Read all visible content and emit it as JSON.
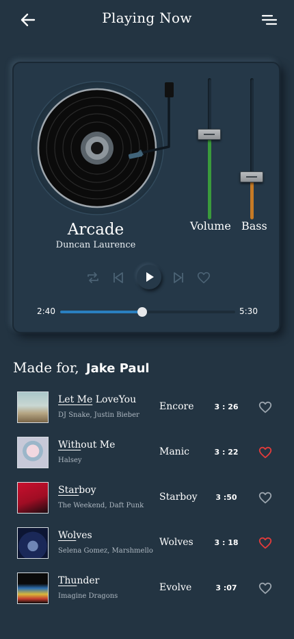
{
  "header": {
    "title": "Playing Now",
    "back_icon": "arrow-left-icon",
    "menu_icon": "menu-icon"
  },
  "player": {
    "track_title": "Arcade",
    "track_artist": "Duncan Laurence",
    "volume_label": "Volume",
    "volume_level": 0.6,
    "bass_label": "Bass",
    "bass_level": 0.3,
    "elapsed": "2:40",
    "duration": "5:30",
    "progress": 0.47,
    "controls": [
      "repeat-icon",
      "previous-icon",
      "play-icon",
      "next-icon",
      "heart-icon"
    ]
  },
  "playlist": {
    "heading_prefix": "Made for,",
    "user": "Jake Paul",
    "songs": [
      {
        "title_underlined": "Let Me",
        "title_rest": " LoveYou",
        "artist": "DJ Snake, Justin Bieber",
        "album": "Encore",
        "duration": "3 : 26",
        "liked": false
      },
      {
        "title_underlined": "With",
        "title_rest": "out Me",
        "artist": "Halsey",
        "album": "Manic",
        "duration": "3 : 22",
        "liked": true
      },
      {
        "title_underlined": "Star",
        "title_rest": "boy",
        "artist": "The Weekend, Daft Punk",
        "album": "Starboy",
        "duration": "3 :50",
        "liked": false
      },
      {
        "title_underlined": "Wol",
        "title_rest": "ves",
        "artist": "Selena Gomez, Marshmello",
        "album": "Wolves",
        "duration": "3 : 18",
        "liked": true
      },
      {
        "title_underlined": "Thu",
        "title_rest": "nder",
        "artist": "Imagine Dragons",
        "album": "Evolve",
        "duration": "3 :07",
        "liked": false
      }
    ]
  },
  "colors": {
    "background": "#233442",
    "volume": "#3a9a3c",
    "bass": "#c67a25",
    "progress": "#2a7fbf",
    "liked": "#e23b3b",
    "unliked": "#9aa4ad"
  }
}
